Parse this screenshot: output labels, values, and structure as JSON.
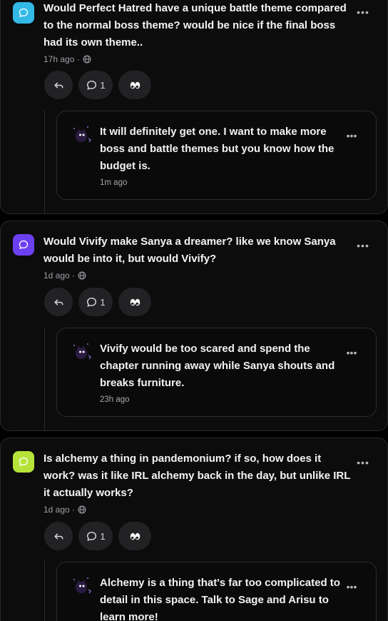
{
  "posts": [
    {
      "question": "Would Perfect Hatred have a unique battle theme compared to the normal boss theme? would be nice if the final boss had its own theme..",
      "time": "17h ago ·",
      "comment_count": "1",
      "icon_color": "#33b9e6",
      "reply": {
        "text": "It will definitely get one. I want to make more boss and battle themes but you know how the budget is.",
        "time": "1m ago"
      }
    },
    {
      "question": "Would Vivify make Sanya a dreamer? like we know Sanya would be into it, but would Vivify?",
      "time": "1d ago ·",
      "comment_count": "1",
      "icon_color": "#6b3ff2",
      "reply": {
        "text": "Vivify would be too scared and spend the chapter running away while Sanya shouts and breaks furniture.",
        "time": "23h ago"
      }
    },
    {
      "question": "Is alchemy a thing in pandemonium? if so, how does it work? was it like IRL alchemy back in the day, but unlike IRL it actually works?",
      "time": "1d ago ·",
      "comment_count": "1",
      "icon_color": "#b6e33a",
      "reply": {
        "text": "Alchemy is a thing that's far too complicated to detail in this space. Talk to Sage and Arisu to learn more!",
        "time": ""
      }
    }
  ]
}
